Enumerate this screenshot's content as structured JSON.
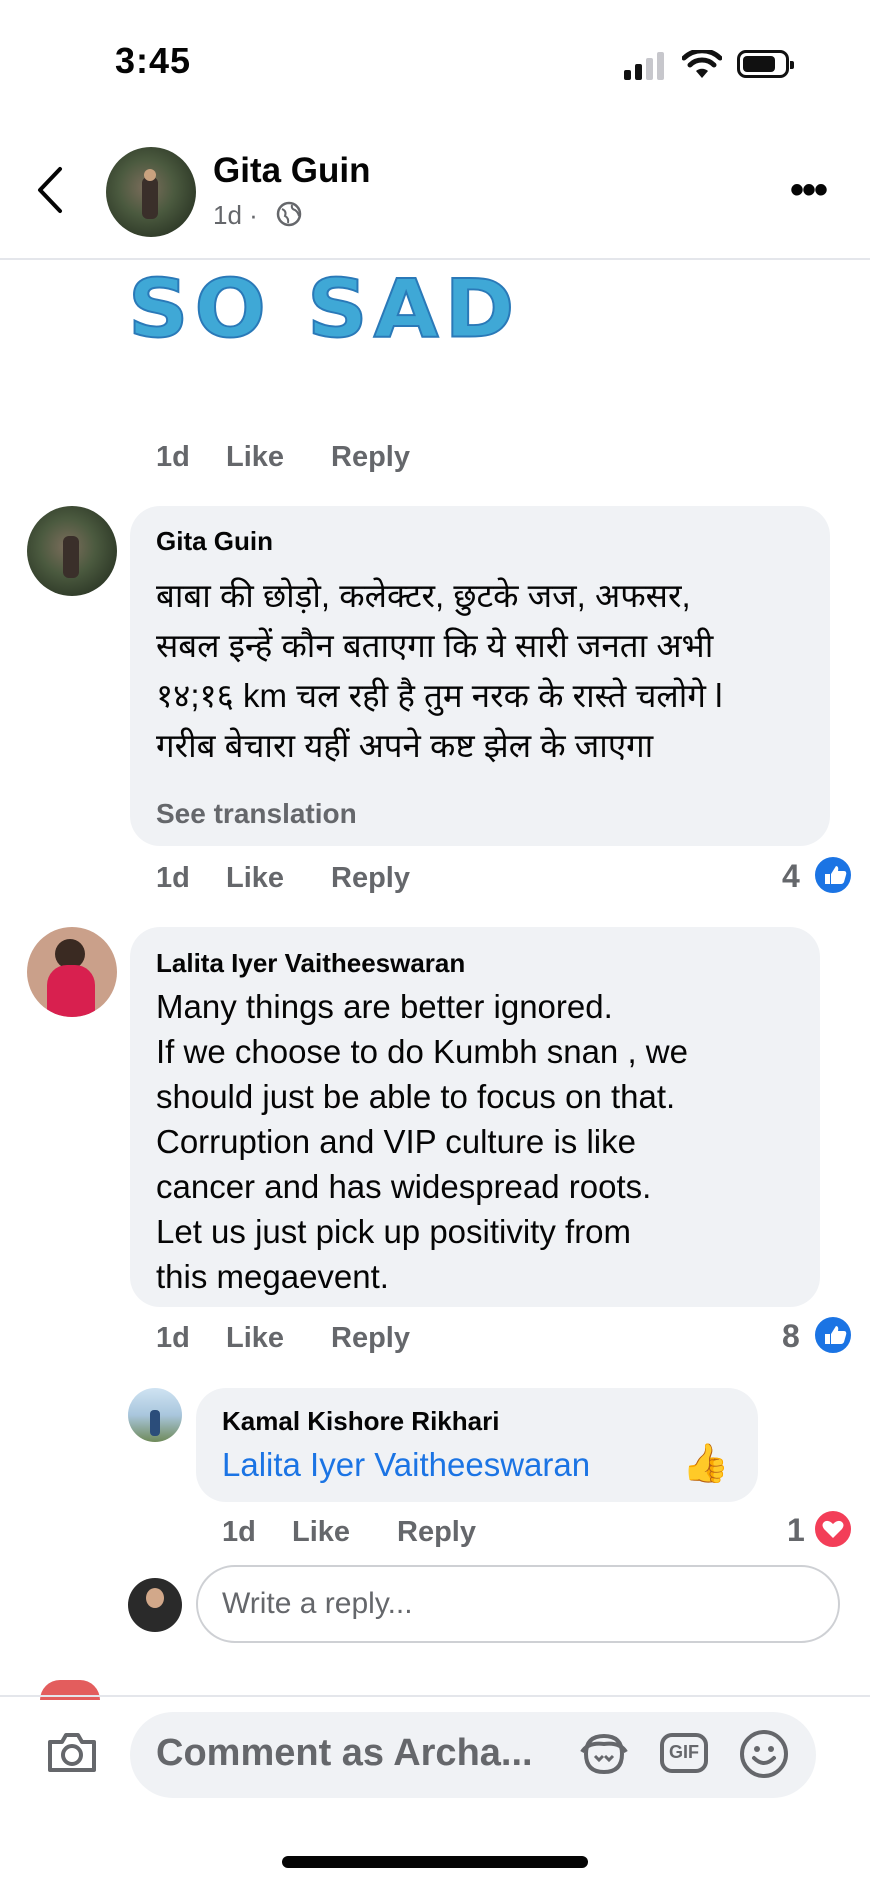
{
  "status_bar": {
    "time": "3:45"
  },
  "header": {
    "name": "Gita Guin",
    "meta": "1d ·",
    "more_label": "•••"
  },
  "sticker_text": "SO SAD",
  "sticker_actions": {
    "time": "1d",
    "like": "Like",
    "reply": "Reply"
  },
  "comments": [
    {
      "author": "Gita Guin",
      "lines": [
        "बाबा की छोड़ो, कलेक्टर, छुटके जज, अफसर,",
        "सबल इन्हें कौन बताएगा कि ये सारी जनता अभी",
        "१४;१६ km चल रही है तुम नरक के रास्ते चलोगे l",
        "गरीब बेचारा यहीं अपने कष्ट झेल के जाएगा"
      ],
      "see_translation": "See translation",
      "time": "1d",
      "like": "Like",
      "reply": "Reply",
      "reaction_count": "4"
    },
    {
      "author": "Lalita Iyer Vaitheeswaran",
      "lines": [
        "Many things are better ignored.",
        "If we choose to do Kumbh snan , we",
        "should just be able to focus on that.",
        "Corruption and VIP culture is like",
        "cancer and has widespread roots.",
        "Let us just pick up positivity from",
        "this megaevent."
      ],
      "time": "1d",
      "like": "Like",
      "reply": "Reply",
      "reaction_count": "8"
    }
  ],
  "reply": {
    "author": "Kamal Kishore Rikhari",
    "mention": "Lalita Iyer Vaitheeswaran",
    "emoji": "👍",
    "time": "1d",
    "like": "Like",
    "reply": "Reply",
    "reaction_count": "1"
  },
  "reply_input": {
    "placeholder": "Write a reply..."
  },
  "comment_bar": {
    "placeholder": "Comment as Archa...",
    "gif": "GIF"
  },
  "colors": {
    "accent": "#1b74e4",
    "heart": "#f33e58",
    "bubble": "#f0f2f5",
    "muted": "#65676b"
  }
}
